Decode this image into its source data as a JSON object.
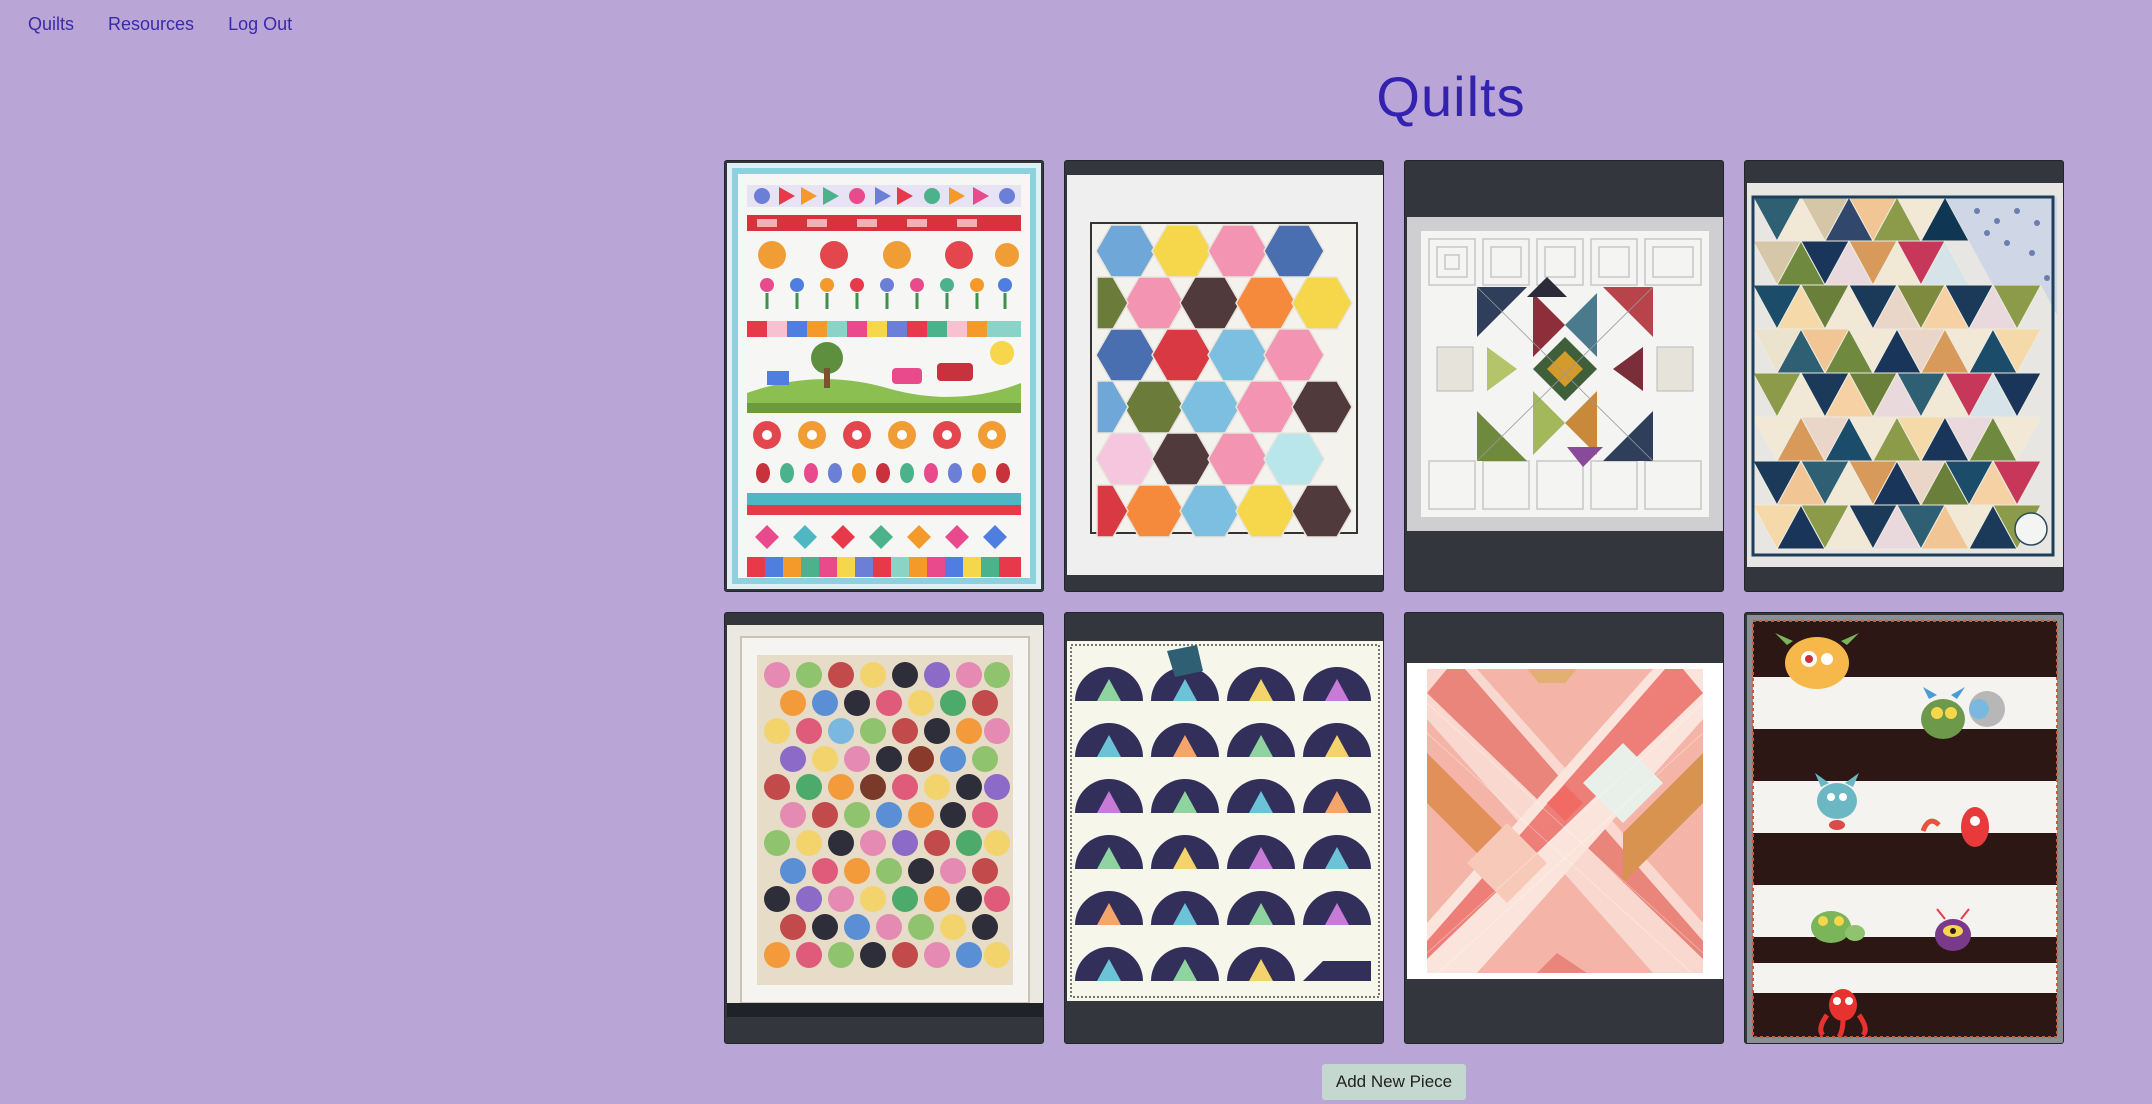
{
  "nav": {
    "items": [
      {
        "label": "Quilts"
      },
      {
        "label": "Resources"
      },
      {
        "label": "Log Out"
      }
    ]
  },
  "page": {
    "title": "Quilts"
  },
  "quilts": [
    {
      "pattern": "row-sampler"
    },
    {
      "pattern": "hexagon"
    },
    {
      "pattern": "log-cabin"
    },
    {
      "pattern": "triangles"
    },
    {
      "pattern": "grandmothers-flower-garden"
    },
    {
      "pattern": "spiky-fans"
    },
    {
      "pattern": "pink-x-stripes"
    },
    {
      "pattern": "monster-stripes"
    }
  ],
  "actions": {
    "add_label": "Add New Piece"
  },
  "colors": {
    "background": "#b9a5d6",
    "nav_link": "#3b2aa8",
    "title": "#3321b0",
    "card": "#33373d",
    "button": "#c5d8cf"
  }
}
